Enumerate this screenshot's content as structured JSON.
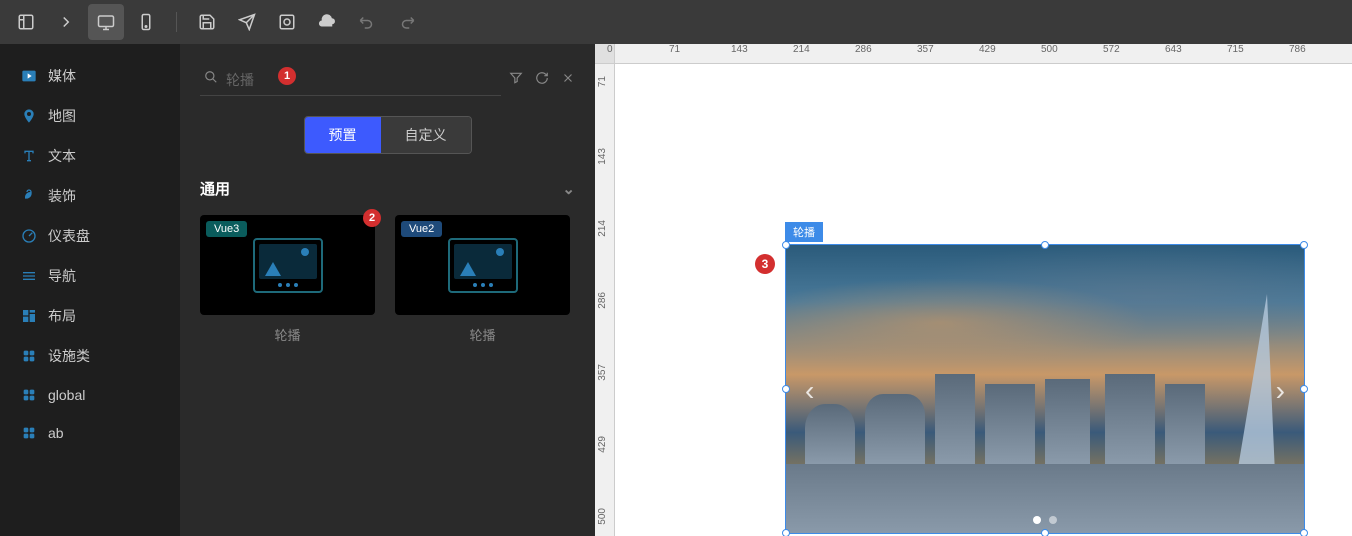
{
  "toolbar": {
    "items": [
      "logo",
      "chevron-right",
      "desktop",
      "mobile",
      "sep",
      "save",
      "send",
      "inspect",
      "cloud",
      "undo",
      "redo"
    ]
  },
  "sidebar": {
    "items": [
      {
        "icon": "media",
        "label": "媒体",
        "color": "#2a7fb8"
      },
      {
        "icon": "map",
        "label": "地图",
        "color": "#2a7fb8"
      },
      {
        "icon": "text",
        "label": "文本",
        "color": "#2a7fb8"
      },
      {
        "icon": "decorate",
        "label": "装饰",
        "color": "#2a7fb8"
      },
      {
        "icon": "dashboard",
        "label": "仪表盘",
        "color": "#2a7fb8"
      },
      {
        "icon": "nav",
        "label": "导航",
        "color": "#2a7fb8"
      },
      {
        "icon": "layout",
        "label": "布局",
        "color": "#2a7fb8"
      },
      {
        "icon": "facility",
        "label": "设施类",
        "color": "#2a7fb8"
      },
      {
        "icon": "global",
        "label": "global",
        "color": "#2a7fb8"
      },
      {
        "icon": "ab",
        "label": "ab",
        "color": "#2a7fb8"
      }
    ]
  },
  "panel": {
    "search_placeholder": "轮播",
    "tabs": {
      "preset": "预置",
      "custom": "自定义"
    },
    "section": {
      "title": "通用"
    },
    "cards": [
      {
        "tag": "Vue3",
        "label": "轮播"
      },
      {
        "tag": "Vue2",
        "label": "轮播"
      }
    ]
  },
  "canvas": {
    "component_tag": "轮播",
    "ruler_h": [
      0,
      71,
      143,
      214,
      286,
      357,
      429,
      500,
      572,
      643,
      715,
      786
    ],
    "ruler_v": [
      71,
      143,
      214,
      286,
      357,
      429,
      500
    ]
  },
  "annotations": {
    "b1": "1",
    "b2": "2",
    "b3": "3"
  }
}
